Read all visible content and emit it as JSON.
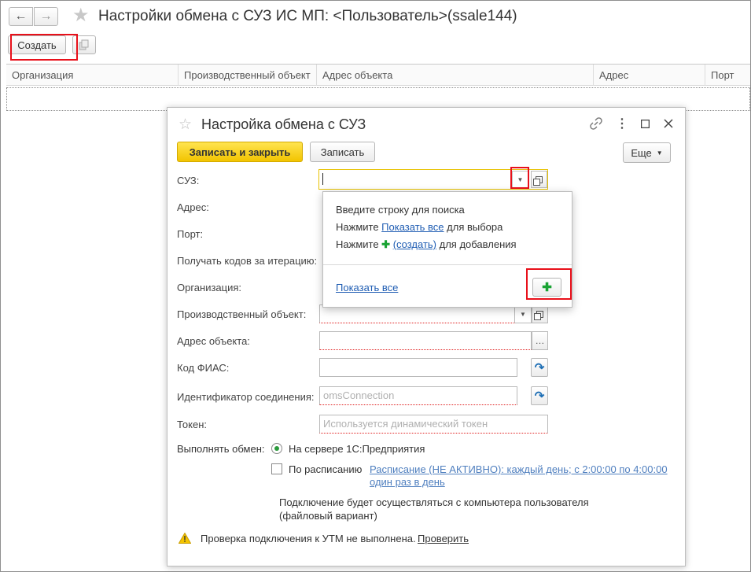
{
  "main": {
    "title": "Настройки обмена с СУЗ ИС МП: <Пользователь>(ssale144)",
    "nav": {
      "back_icon": "←",
      "forward_icon": "→"
    },
    "toolbar": {
      "create_label": "Создать",
      "copy_icon": "copy-icon"
    },
    "grid": {
      "columns": [
        "Организация",
        "Производственный объект",
        "Адрес объекта",
        "Адрес",
        "Порт"
      ]
    }
  },
  "dialog": {
    "title": "Настройка обмена с СУЗ",
    "buttons": {
      "save_close": "Записать и закрыть",
      "save": "Записать",
      "more": "Еще"
    },
    "fields": {
      "suz": {
        "label": "СУЗ:",
        "value": ""
      },
      "address": {
        "label": "Адрес:"
      },
      "port": {
        "label": "Порт:"
      },
      "codes_per_iter": {
        "label": "Получать кодов за итерацию:"
      },
      "organization": {
        "label": "Организация:"
      },
      "prod_object": {
        "label": "Производственный объект:"
      },
      "object_address": {
        "label": "Адрес объекта:"
      },
      "fias": {
        "label": "Код ФИАС:"
      },
      "conn_id": {
        "label": "Идентификатор соединения:",
        "placeholder": "omsConnection"
      },
      "token": {
        "label": "Токен:",
        "placeholder": "Используется динамический токен"
      }
    },
    "popup": {
      "line1": "Введите строку для поиска",
      "line2_prefix": "Нажмите ",
      "line2_link": "Показать все",
      "line2_suffix": " для выбора",
      "line3_prefix": "Нажмите ",
      "line3_link": "(создать)",
      "line3_suffix": " для добавления",
      "show_all": "Показать все"
    },
    "exchange": {
      "label": "Выполнять обмен:",
      "on_server": "На сервере 1С:Предприятия",
      "on_server_selected": true,
      "by_schedule": "По расписанию",
      "by_schedule_checked": false,
      "schedule_link": "Расписание (НЕ АКТИВНО): каждый день; с 2:00:00 по 4:00:00 один раз в день"
    },
    "info": {
      "connection_line1": "Подключение будет осуществляться с компьютера пользователя",
      "connection_line2": "(файловый вариант)"
    },
    "warning": {
      "text": "Проверка подключения к УТМ не выполнена.",
      "link": "Проверить"
    }
  },
  "colors": {
    "accent_yellow": "#f2c400",
    "highlight_red": "#e8101a",
    "link_blue": "#1f5db3",
    "plus_green": "#1aa334"
  }
}
